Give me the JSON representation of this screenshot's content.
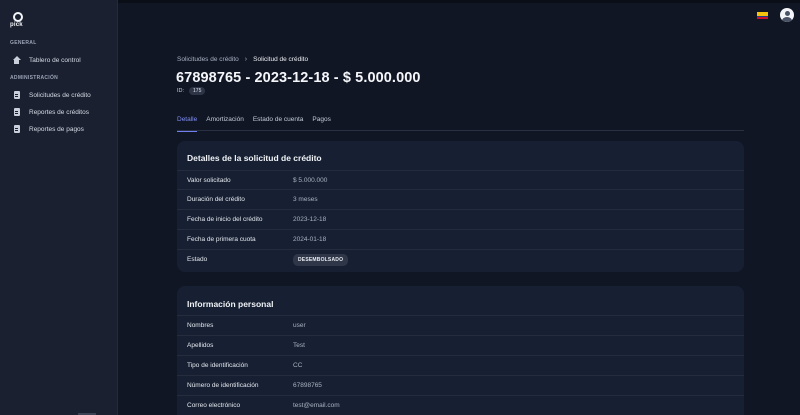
{
  "sidebar": {
    "logo_text": "pick",
    "sections": [
      {
        "title": "GENERAL",
        "items": [
          {
            "label": "Tablero de control",
            "icon": "home-icon"
          }
        ]
      },
      {
        "title": "ADMINISTRACIÓN",
        "items": [
          {
            "label": "Solicitudes de crédito",
            "icon": "document-icon"
          },
          {
            "label": "Reportes de créditos",
            "icon": "document-icon"
          },
          {
            "label": "Reportes de pagos",
            "icon": "document-icon"
          }
        ]
      }
    ]
  },
  "header": {
    "flag_icon": "colombia-flag-icon",
    "avatar_icon": "user-avatar-icon"
  },
  "breadcrumb": {
    "parent": "Solicitudes de crédito",
    "separator": "›",
    "current": "Solicitud de crédito"
  },
  "title": "67898765 - 2023-12-18 - $ 5.000.000",
  "id": {
    "label": "ID:",
    "value": "175"
  },
  "tabs": [
    "Detalle",
    "Amortización",
    "Estado de cuenta",
    "Pagos"
  ],
  "credit_details": {
    "title": "Detalles de la solicitud de crédito",
    "rows": [
      {
        "label": "Valor solicitado",
        "value": "$ 5.000.000"
      },
      {
        "label": "Duración del crédito",
        "value": "3 meses"
      },
      {
        "label": "Fecha de inicio del crédito",
        "value": "2023-12-18"
      },
      {
        "label": "Fecha de primera cuota",
        "value": "2024-01-18"
      },
      {
        "label": "Estado",
        "value": "DESEMBOLSADO"
      }
    ]
  },
  "personal_info": {
    "title": "Información personal",
    "rows": [
      {
        "label": "Nombres",
        "value": "user"
      },
      {
        "label": "Apellidos",
        "value": "Test"
      },
      {
        "label": "Tipo de identificación",
        "value": "CC"
      },
      {
        "label": "Número de identificación",
        "value": "67898765"
      },
      {
        "label": "Correo electrónico",
        "value": "test@email.com"
      }
    ]
  },
  "colors": {
    "accent": "#6f7ff0",
    "background": "#101624",
    "sidebar": "#1a2030",
    "card": "#172032"
  }
}
